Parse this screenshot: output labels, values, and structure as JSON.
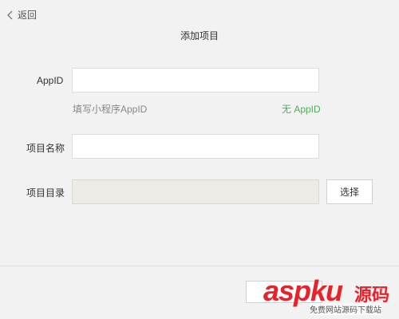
{
  "header": {
    "back_label": "返回",
    "title": "添加项目"
  },
  "form": {
    "appid": {
      "label": "AppID",
      "value": "",
      "hint": "填写小程序AppID",
      "no_appid_link": "无 AppID"
    },
    "project_name": {
      "label": "项目名称",
      "value": ""
    },
    "project_dir": {
      "label": "项目目录",
      "value": "",
      "choose_label": "选择"
    }
  },
  "watermark": {
    "brand": "aspku",
    "brand_cn": "源码",
    "subtitle": "免费网站源码下载站"
  },
  "colors": {
    "link_green": "#4bb058",
    "watermark_red": "#e8222a"
  }
}
